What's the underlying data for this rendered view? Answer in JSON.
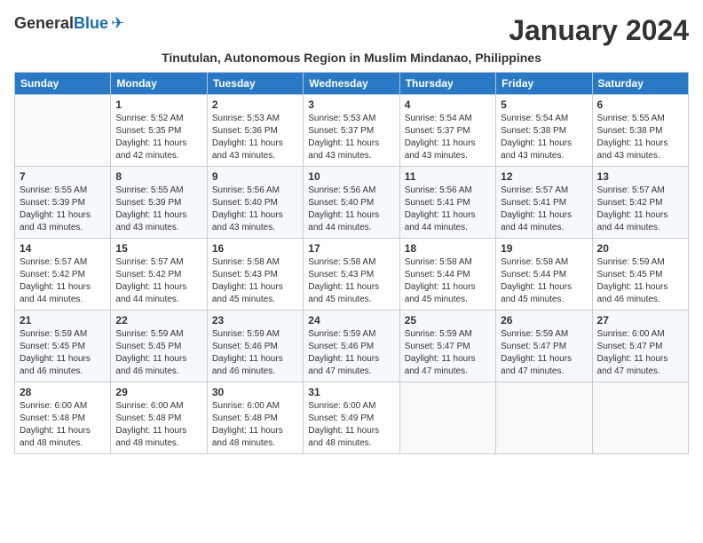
{
  "header": {
    "logo_general": "General",
    "logo_blue": "Blue",
    "month_title": "January 2024",
    "subtitle": "Tinutulan, Autonomous Region in Muslim Mindanao, Philippines"
  },
  "days_of_week": [
    "Sunday",
    "Monday",
    "Tuesday",
    "Wednesday",
    "Thursday",
    "Friday",
    "Saturday"
  ],
  "weeks": [
    [
      {
        "day": "",
        "sunrise": "",
        "sunset": "",
        "daylight": ""
      },
      {
        "day": "1",
        "sunrise": "Sunrise: 5:52 AM",
        "sunset": "Sunset: 5:35 PM",
        "daylight": "Daylight: 11 hours and 42 minutes."
      },
      {
        "day": "2",
        "sunrise": "Sunrise: 5:53 AM",
        "sunset": "Sunset: 5:36 PM",
        "daylight": "Daylight: 11 hours and 43 minutes."
      },
      {
        "day": "3",
        "sunrise": "Sunrise: 5:53 AM",
        "sunset": "Sunset: 5:37 PM",
        "daylight": "Daylight: 11 hours and 43 minutes."
      },
      {
        "day": "4",
        "sunrise": "Sunrise: 5:54 AM",
        "sunset": "Sunset: 5:37 PM",
        "daylight": "Daylight: 11 hours and 43 minutes."
      },
      {
        "day": "5",
        "sunrise": "Sunrise: 5:54 AM",
        "sunset": "Sunset: 5:38 PM",
        "daylight": "Daylight: 11 hours and 43 minutes."
      },
      {
        "day": "6",
        "sunrise": "Sunrise: 5:55 AM",
        "sunset": "Sunset: 5:38 PM",
        "daylight": "Daylight: 11 hours and 43 minutes."
      }
    ],
    [
      {
        "day": "7",
        "sunrise": "Sunrise: 5:55 AM",
        "sunset": "Sunset: 5:39 PM",
        "daylight": "Daylight: 11 hours and 43 minutes."
      },
      {
        "day": "8",
        "sunrise": "Sunrise: 5:55 AM",
        "sunset": "Sunset: 5:39 PM",
        "daylight": "Daylight: 11 hours and 43 minutes."
      },
      {
        "day": "9",
        "sunrise": "Sunrise: 5:56 AM",
        "sunset": "Sunset: 5:40 PM",
        "daylight": "Daylight: 11 hours and 43 minutes."
      },
      {
        "day": "10",
        "sunrise": "Sunrise: 5:56 AM",
        "sunset": "Sunset: 5:40 PM",
        "daylight": "Daylight: 11 hours and 44 minutes."
      },
      {
        "day": "11",
        "sunrise": "Sunrise: 5:56 AM",
        "sunset": "Sunset: 5:41 PM",
        "daylight": "Daylight: 11 hours and 44 minutes."
      },
      {
        "day": "12",
        "sunrise": "Sunrise: 5:57 AM",
        "sunset": "Sunset: 5:41 PM",
        "daylight": "Daylight: 11 hours and 44 minutes."
      },
      {
        "day": "13",
        "sunrise": "Sunrise: 5:57 AM",
        "sunset": "Sunset: 5:42 PM",
        "daylight": "Daylight: 11 hours and 44 minutes."
      }
    ],
    [
      {
        "day": "14",
        "sunrise": "Sunrise: 5:57 AM",
        "sunset": "Sunset: 5:42 PM",
        "daylight": "Daylight: 11 hours and 44 minutes."
      },
      {
        "day": "15",
        "sunrise": "Sunrise: 5:57 AM",
        "sunset": "Sunset: 5:42 PM",
        "daylight": "Daylight: 11 hours and 44 minutes."
      },
      {
        "day": "16",
        "sunrise": "Sunrise: 5:58 AM",
        "sunset": "Sunset: 5:43 PM",
        "daylight": "Daylight: 11 hours and 45 minutes."
      },
      {
        "day": "17",
        "sunrise": "Sunrise: 5:58 AM",
        "sunset": "Sunset: 5:43 PM",
        "daylight": "Daylight: 11 hours and 45 minutes."
      },
      {
        "day": "18",
        "sunrise": "Sunrise: 5:58 AM",
        "sunset": "Sunset: 5:44 PM",
        "daylight": "Daylight: 11 hours and 45 minutes."
      },
      {
        "day": "19",
        "sunrise": "Sunrise: 5:58 AM",
        "sunset": "Sunset: 5:44 PM",
        "daylight": "Daylight: 11 hours and 45 minutes."
      },
      {
        "day": "20",
        "sunrise": "Sunrise: 5:59 AM",
        "sunset": "Sunset: 5:45 PM",
        "daylight": "Daylight: 11 hours and 46 minutes."
      }
    ],
    [
      {
        "day": "21",
        "sunrise": "Sunrise: 5:59 AM",
        "sunset": "Sunset: 5:45 PM",
        "daylight": "Daylight: 11 hours and 46 minutes."
      },
      {
        "day": "22",
        "sunrise": "Sunrise: 5:59 AM",
        "sunset": "Sunset: 5:45 PM",
        "daylight": "Daylight: 11 hours and 46 minutes."
      },
      {
        "day": "23",
        "sunrise": "Sunrise: 5:59 AM",
        "sunset": "Sunset: 5:46 PM",
        "daylight": "Daylight: 11 hours and 46 minutes."
      },
      {
        "day": "24",
        "sunrise": "Sunrise: 5:59 AM",
        "sunset": "Sunset: 5:46 PM",
        "daylight": "Daylight: 11 hours and 47 minutes."
      },
      {
        "day": "25",
        "sunrise": "Sunrise: 5:59 AM",
        "sunset": "Sunset: 5:47 PM",
        "daylight": "Daylight: 11 hours and 47 minutes."
      },
      {
        "day": "26",
        "sunrise": "Sunrise: 5:59 AM",
        "sunset": "Sunset: 5:47 PM",
        "daylight": "Daylight: 11 hours and 47 minutes."
      },
      {
        "day": "27",
        "sunrise": "Sunrise: 6:00 AM",
        "sunset": "Sunset: 5:47 PM",
        "daylight": "Daylight: 11 hours and 47 minutes."
      }
    ],
    [
      {
        "day": "28",
        "sunrise": "Sunrise: 6:00 AM",
        "sunset": "Sunset: 5:48 PM",
        "daylight": "Daylight: 11 hours and 48 minutes."
      },
      {
        "day": "29",
        "sunrise": "Sunrise: 6:00 AM",
        "sunset": "Sunset: 5:48 PM",
        "daylight": "Daylight: 11 hours and 48 minutes."
      },
      {
        "day": "30",
        "sunrise": "Sunrise: 6:00 AM",
        "sunset": "Sunset: 5:48 PM",
        "daylight": "Daylight: 11 hours and 48 minutes."
      },
      {
        "day": "31",
        "sunrise": "Sunrise: 6:00 AM",
        "sunset": "Sunset: 5:49 PM",
        "daylight": "Daylight: 11 hours and 48 minutes."
      },
      {
        "day": "",
        "sunrise": "",
        "sunset": "",
        "daylight": ""
      },
      {
        "day": "",
        "sunrise": "",
        "sunset": "",
        "daylight": ""
      },
      {
        "day": "",
        "sunrise": "",
        "sunset": "",
        "daylight": ""
      }
    ]
  ]
}
